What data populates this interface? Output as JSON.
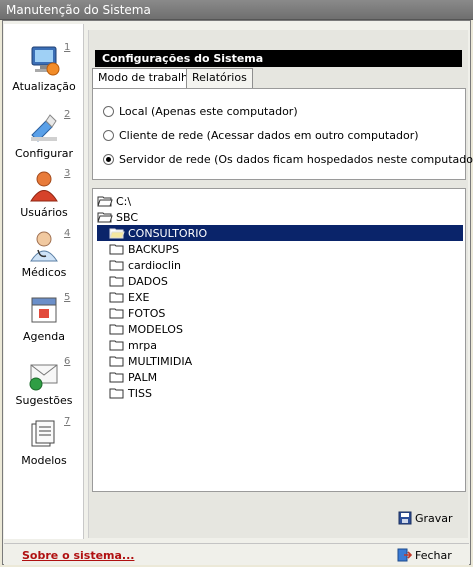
{
  "window": {
    "title": "Manutenção do Sistema"
  },
  "nav": [
    {
      "number": "1",
      "label": "Atualização",
      "icon": "monitor-update-icon"
    },
    {
      "number": "2",
      "label": "Configurar",
      "icon": "configure-icon"
    },
    {
      "number": "3",
      "label": "Usuários",
      "icon": "user-icon"
    },
    {
      "number": "4",
      "label": "Médicos",
      "icon": "doctor-icon"
    },
    {
      "number": "5",
      "label": "Agenda",
      "icon": "calendar-icon"
    },
    {
      "number": "6",
      "label": "Sugestões",
      "icon": "envelope-icon"
    },
    {
      "number": "7",
      "label": "Modelos",
      "icon": "document-template-icon"
    }
  ],
  "main": {
    "section_title": "Configurações do Sistema",
    "tabs": [
      {
        "label": "Modo de trabalho",
        "active": true
      },
      {
        "label": "Relatórios",
        "active": false
      }
    ],
    "mode_options": [
      {
        "label": "Local (Apenas este computador)",
        "selected": false
      },
      {
        "label": "Cliente de rede (Acessar dados em outro computador)",
        "selected": false
      },
      {
        "label": "Servidor de rede (Os dados ficam hospedados neste computador)",
        "selected": true
      }
    ],
    "tree": [
      {
        "label": "C:\\",
        "depth": 0,
        "open": true,
        "selected": false
      },
      {
        "label": "SBC",
        "depth": 1,
        "open": true,
        "selected": false
      },
      {
        "label": "CONSULTORIO",
        "depth": 2,
        "open": true,
        "selected": true
      },
      {
        "label": "BACKUPS",
        "depth": 3,
        "open": false,
        "selected": false
      },
      {
        "label": "cardioclin",
        "depth": 3,
        "open": false,
        "selected": false
      },
      {
        "label": "DADOS",
        "depth": 3,
        "open": false,
        "selected": false
      },
      {
        "label": "EXE",
        "depth": 3,
        "open": false,
        "selected": false
      },
      {
        "label": "FOTOS",
        "depth": 3,
        "open": false,
        "selected": false
      },
      {
        "label": "MODELOS",
        "depth": 3,
        "open": false,
        "selected": false
      },
      {
        "label": "mrpa",
        "depth": 3,
        "open": false,
        "selected": false
      },
      {
        "label": "MULTIMIDIA",
        "depth": 3,
        "open": false,
        "selected": false
      },
      {
        "label": "PALM",
        "depth": 3,
        "open": false,
        "selected": false
      },
      {
        "label": "TISS",
        "depth": 3,
        "open": false,
        "selected": false
      }
    ],
    "save_label": "Gravar"
  },
  "footer": {
    "about_label": "Sobre o sistema...",
    "close_label": "Fechar"
  },
  "colors": {
    "selection": "#0a246a",
    "about_link": "#b01010",
    "title_bar": "#7c7c7c"
  }
}
